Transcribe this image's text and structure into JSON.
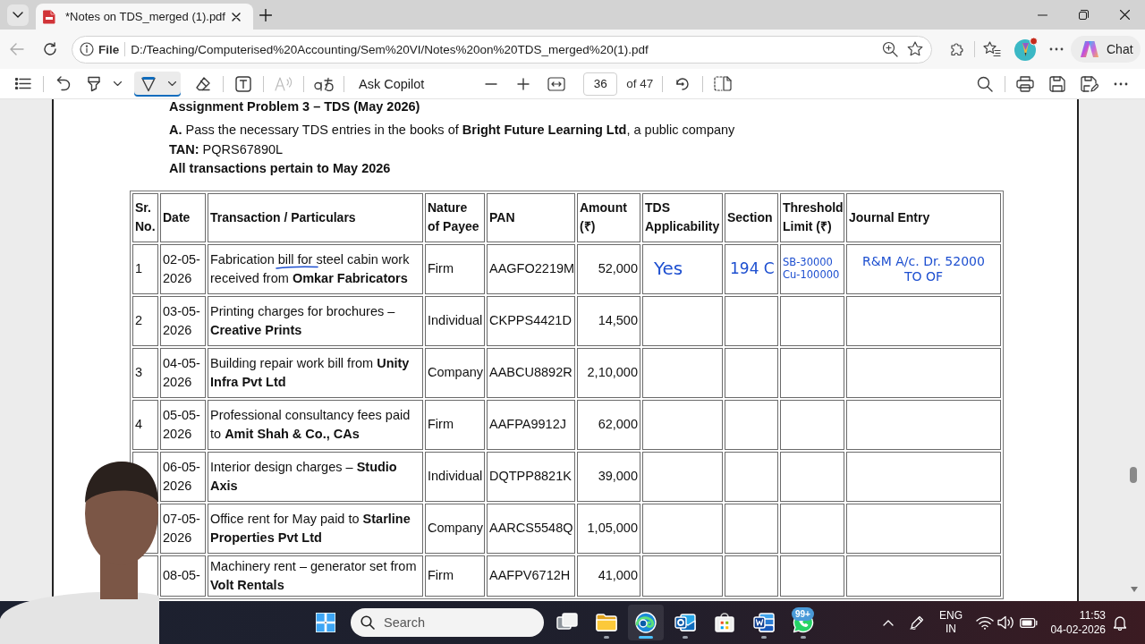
{
  "browser": {
    "tabs": [
      {
        "title": "*Notes on TDS_merged (1).pdf",
        "selected": true
      }
    ],
    "back": {
      "disabled": true
    },
    "address": {
      "scheme": "File",
      "url": "D:/Teaching/Computerised%20Accounting/Sem%20VI/Notes%20on%20TDS_merged%20(1).pdf"
    },
    "chat": {
      "label": "Chat"
    }
  },
  "pdf_toolbar": {
    "tools": [
      {
        "kind": "highlighter",
        "selected": false
      },
      {
        "kind": "pen",
        "selected": true
      },
      {
        "kind": "eraser",
        "selected": false
      },
      {
        "kind": "textbox",
        "selected": false
      }
    ],
    "read_aloud": {
      "disabled": true
    },
    "copilot": {
      "label": "Ask Copilot"
    },
    "page": {
      "value": "36",
      "total": "of 47"
    }
  },
  "document": {
    "heading": "Assignment Problem 3 – TDS (May 2026)",
    "lines": [
      "**A.** Pass the necessary TDS entries in the books of **Bright Future Learning Ltd**, a public company",
      "**TAN:** PQRS67890L"
    ],
    "note": "All transactions pertain to May 2026",
    "table": {
      "columns": [
        "Sr. No.",
        "Date",
        "Transaction / Particulars",
        "Nature of Payee",
        "PAN",
        "Amount (₹)",
        "TDS Applicability",
        "Section",
        "Threshold Limit (₹)",
        "Journal Entry"
      ],
      "rows": [
        {
          "sr": "1",
          "date": "02-05-2026",
          "particulars": "Fabrication bill for steel cabin work received from **Omkar Fabricators**",
          "nature": "Firm",
          "pan": "AAGFO2219M",
          "amount": "52,000",
          "ink_underline": true,
          "handwriting": {
            "tds_applicability": [
              "Yes"
            ],
            "section": [
              "194 C"
            ],
            "threshold_limit": [
              "SB-30000",
              "Cu-100000"
            ],
            "journal_entry": [
              "R&M A/c. Dr. 52000",
              "TO OF"
            ]
          }
        },
        {
          "sr": "2",
          "date": "03-05-2026",
          "particulars": "Printing charges for brochures – **Creative Prints**",
          "nature": "Individual",
          "pan": "CKPPS4421D",
          "amount": "14,500"
        },
        {
          "sr": "3",
          "date": "04-05-2026",
          "particulars": "Building repair work bill from **Unity Infra Pvt Ltd**",
          "nature": "Company",
          "pan": "AABCU8892R",
          "amount": "2,10,000"
        },
        {
          "sr": "4",
          "date": "05-05-2026",
          "particulars": "Professional consultancy fees paid to **Amit Shah & Co., CAs**",
          "nature": "Firm",
          "pan": "AAFPA9912J",
          "amount": "62,000"
        },
        {
          "date": "06-05-2026",
          "particulars": "Interior design charges – **Studio Axis**",
          "nature": "Individual",
          "pan": "DQTPP8821K",
          "amount": "39,000"
        },
        {
          "date": "07-05-2026",
          "particulars": "Office rent for May paid to **Starline Properties Pvt Ltd**",
          "nature": "Company",
          "pan": "AARCS5548Q",
          "amount": "1,05,000"
        },
        {
          "date": "08-05-",
          "particulars": "Machinery rent – generator set from **Volt Rentals**",
          "nature": "Firm",
          "pan": "AAFPV6712H",
          "amount": "41,000"
        }
      ]
    }
  },
  "taskbar": {
    "search": {
      "placeholder": "Search"
    },
    "apps": [
      {
        "kind": "task_view",
        "running": false,
        "selected": false
      },
      {
        "kind": "explorer",
        "running": true,
        "selected": false
      },
      {
        "kind": "edge",
        "running": true,
        "selected": true
      },
      {
        "kind": "outlook",
        "running": true,
        "selected": false
      },
      {
        "kind": "store",
        "running": false,
        "selected": false
      },
      {
        "kind": "word",
        "running": true,
        "selected": false
      },
      {
        "kind": "whatsapp",
        "running": true,
        "selected": false,
        "badge": "99+"
      }
    ],
    "tray": {
      "language": "ENG",
      "region": "IN",
      "time": "11:53",
      "date": "04-02-2026"
    }
  }
}
